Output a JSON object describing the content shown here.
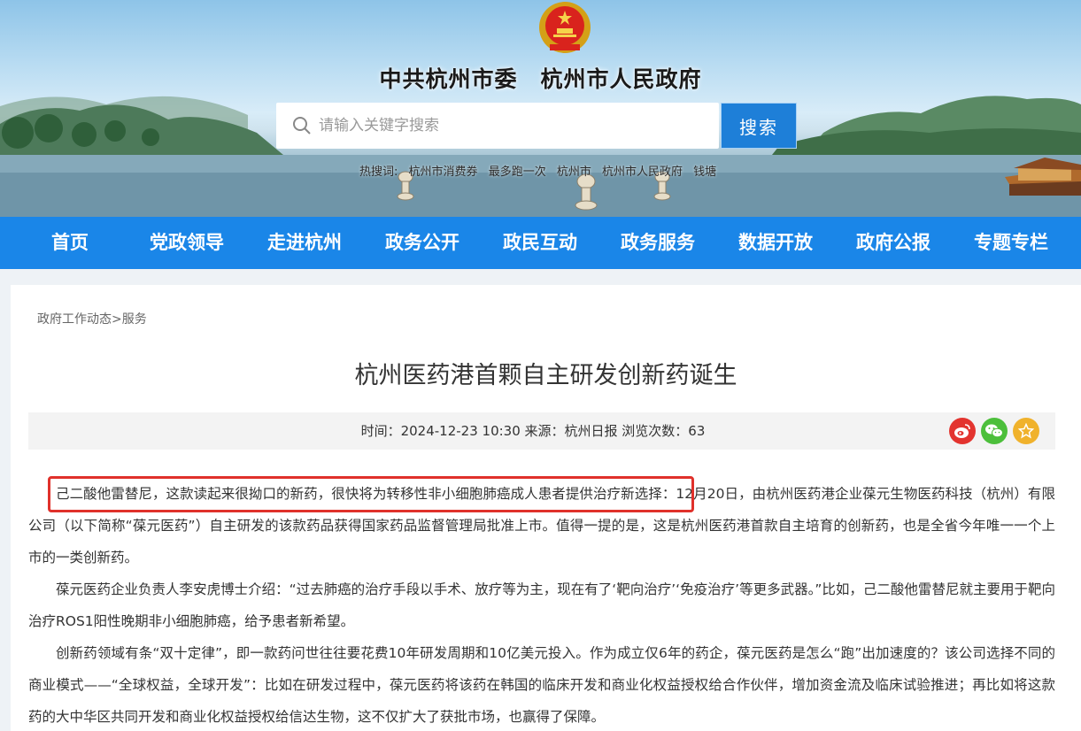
{
  "header": {
    "site_title": "中共杭州市委　杭州市人民政府",
    "search_placeholder": "请输入关键字搜索",
    "search_button": "搜索",
    "hot_search": [
      "热搜词:",
      "杭州市消费券",
      "最多跑一次",
      "杭州市",
      "杭州市人民政府",
      "钱塘"
    ]
  },
  "nav": {
    "items": [
      "首页",
      "党政领导",
      "走进杭州",
      "政务公开",
      "政民互动",
      "政务服务",
      "数据开放",
      "政府公报",
      "专题专栏"
    ]
  },
  "breadcrumb": {
    "parent": "政府工作动态",
    "separator": ">",
    "current": "服务"
  },
  "article": {
    "title": "杭州医药港首颗自主研发创新药诞生",
    "meta": "时间：2024-12-23 10:30 来源：杭州日报 浏览次数：63",
    "paragraphs": [
      "己二酸他雷替尼，这款读起来很拗口的新药，很快将为转移性非小细胞肺癌成人患者提供治疗新选择：12月20日，由杭州医药港企业葆元生物医药科技（杭州）有限公司（以下简称“葆元医药”）自主研发的该款药品获得国家药品监督管理局批准上市。值得一提的是，这是杭州医药港首款自主培育的创新药，也是全省今年唯一一个上市的一类创新药。",
      "葆元医药企业负责人李安虎博士介绍：“过去肺癌的治疗手段以手术、放疗等为主，现在有了‘靶向治疗’‘免疫治疗’等更多武器。”比如，己二酸他雷替尼就主要用于靶向治疗ROS1阳性晚期非小细胞肺癌，给予患者新希望。",
      "创新药领域有条“双十定律”，即一款药问世往往要花费10年研发周期和10亿美元投入。作为成立仅6年的药企，葆元医药是怎么“跑”出加速度的？该公司选择不同的商业模式——“全球权益，全球开发”：比如在研发过程中，葆元医药将该药在韩国的临床开发和商业化权益授权给合作伙伴，增加资金流及临床试验推进；再比如将这款药的大中华区共同开发和商业化权益授权给信达生物，这不仅扩大了获批市场，也赢得了保障。"
    ]
  },
  "colors": {
    "nav_blue": "#1a86e8",
    "search_button_blue": "#1e7fd8",
    "highlight_red": "#e0312b"
  }
}
